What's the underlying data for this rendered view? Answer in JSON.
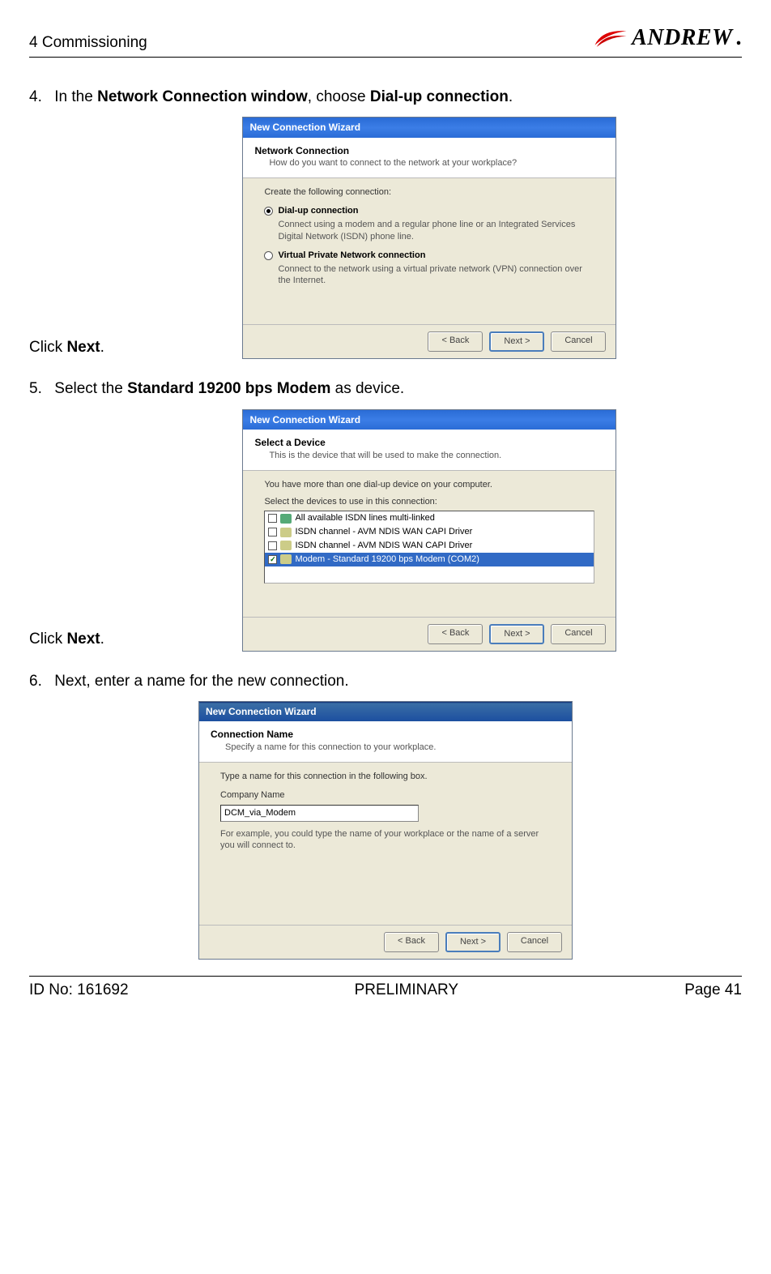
{
  "header": {
    "title": "4 Commissioning",
    "brand": "ANDREW"
  },
  "steps": [
    {
      "num": "4.",
      "text_parts": [
        "In the ",
        "Network Connection window",
        ", choose ",
        "Dial-up connection",
        "."
      ],
      "after": "Click ",
      "after_bold": "Next",
      "after_tail": "."
    },
    {
      "num": "5.",
      "text_parts": [
        "Select the ",
        "Standard 19200 bps Modem",
        " as device."
      ],
      "after": "Click ",
      "after_bold": "Next",
      "after_tail": "."
    },
    {
      "num": "6.",
      "text_parts": [
        "Next, enter a name for the new connection."
      ],
      "after": "",
      "after_bold": "",
      "after_tail": ""
    }
  ],
  "dlg1": {
    "title": "New Connection Wizard",
    "heading": "Network Connection",
    "sub": "How do you want to connect to the network at your workplace?",
    "create": "Create the following connection:",
    "opt1": "Dial-up connection",
    "opt1d": "Connect using a modem and a regular phone line or an Integrated Services Digital Network (ISDN) phone line.",
    "opt2": "Virtual Private Network connection",
    "opt2d": "Connect to the network using a virtual private network (VPN) connection over the Internet.",
    "back": "< Back",
    "next": "Next >",
    "cancel": "Cancel"
  },
  "dlg2": {
    "title": "New Connection Wizard",
    "heading": "Select a Device",
    "sub": "This is the device that will be used to make the connection.",
    "line1": "You have more than one dial-up device on your computer.",
    "line2": "Select the devices to use in this connection:",
    "items": [
      "All available ISDN lines multi-linked",
      "ISDN channel - AVM NDIS WAN CAPI Driver",
      "ISDN channel - AVM NDIS WAN CAPI Driver",
      "Modem - Standard 19200 bps Modem (COM2)"
    ],
    "back": "< Back",
    "next": "Next >",
    "cancel": "Cancel"
  },
  "dlg3": {
    "title": "New Connection Wizard",
    "heading": "Connection Name",
    "sub": "Specify a name for this connection to your workplace.",
    "line1": "Type a name for this connection in the following box.",
    "label": "Company Name",
    "value": "DCM_via_Modem",
    "note": "For example, you could type the name of your workplace or the name of a server you will connect to.",
    "back": "< Back",
    "next": "Next >",
    "cancel": "Cancel"
  },
  "footer": {
    "id": "ID No: 161692",
    "status": "PRELIMINARY",
    "page": "Page 41"
  }
}
